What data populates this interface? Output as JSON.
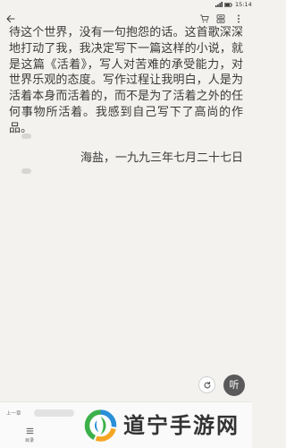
{
  "status_bar": {
    "time": "15:14",
    "icons": [
      "signal-icon",
      "battery-icon"
    ]
  },
  "toolbar": {
    "back_icon": "back-arrow-icon",
    "action_icons": [
      "cart-icon",
      "bookshelf-icon",
      "more-icon"
    ]
  },
  "content": {
    "lines": [
      "待这个世界，没有一句抱怨的话。这首歌深深",
      "地打动了我，我决定写下一篇这样的小说，就",
      "是这篇《活着》，写人对苦难的承受能力，对",
      "世界乐观的态度。写作过程让我明白，人是为",
      "活着本身而活着的，而不是为了活着之外的任",
      "何事物所活着。我感到自己写下了高尚的作",
      "品。"
    ],
    "signature": "海盐，一九九三年七月二十七日",
    "comment_icon": "comment-bubble-icon"
  },
  "floating_buttons": {
    "refresh_icon": "refresh-icon",
    "listen_label": "听"
  },
  "bottom_bar": {
    "prev_chapter_label": "上一章",
    "toc_icon": "toc-list-icon",
    "toc_label": "目录"
  },
  "watermark": {
    "logo": "watermark-logo",
    "text": "道宁手游网"
  },
  "colors": {
    "page_background": "#f4f2ef",
    "text": "#3a3a3a",
    "listen_button": "#5a5a5a",
    "bottom_bar_background": "#fafafa",
    "logo_green": "#3cb04a",
    "logo_blue": "#2a8fd8",
    "logo_orange": "#f5a623"
  }
}
